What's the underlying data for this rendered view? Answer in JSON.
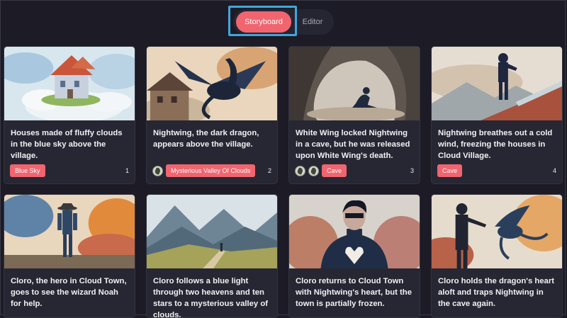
{
  "tabs": [
    {
      "label": "Storyboard",
      "active": true
    },
    {
      "label": "Editor",
      "active": false
    }
  ],
  "colors": {
    "accent": "#f0656f",
    "background": "#1c1b26",
    "card": "#272733",
    "highlight": "#3fa7dc"
  },
  "cards": [
    {
      "image": "floating-house-on-clouds",
      "caption": "Houses made of fluffy clouds in the blue sky above the village.",
      "avatars": 0,
      "tag": "Blue Sky",
      "number": "1"
    },
    {
      "image": "dark-dragon-over-house",
      "caption": "Nightwing, the dark dragon, appears above the village.",
      "avatars": 1,
      "tag": "Mysterious Valley Of Clouds",
      "number": "2"
    },
    {
      "image": "figure-in-cave",
      "caption": "White Wing locked Nightwing in a cave, but he was released upon White Wing's death.",
      "avatars": 2,
      "tag": "Cave",
      "number": "3"
    },
    {
      "image": "hero-on-wall",
      "caption": "Nightwing breathes out a cold wind, freezing the houses in Cloud Village.",
      "avatars": 0,
      "tag": "Cave",
      "number": "4"
    },
    {
      "image": "hero-in-field",
      "caption": "Cloro, the hero in Cloud Town, goes to see the wizard Noah for help.",
      "avatars": 0,
      "tag": "",
      "number": ""
    },
    {
      "image": "mountain-valley",
      "caption": "Cloro follows a blue light through two heavens and ten stars to a mysterious valley of clouds.",
      "avatars": 0,
      "tag": "",
      "number": ""
    },
    {
      "image": "hero-with-heart-emblem",
      "caption": "Cloro returns to Cloud Town with Nightwing's heart, but the town is partially frozen.",
      "avatars": 0,
      "tag": "",
      "number": ""
    },
    {
      "image": "hero-and-dragon",
      "caption": "Cloro holds the dragon's heart aloft and traps Nightwing in the cave again.",
      "avatars": 0,
      "tag": "",
      "number": ""
    }
  ]
}
